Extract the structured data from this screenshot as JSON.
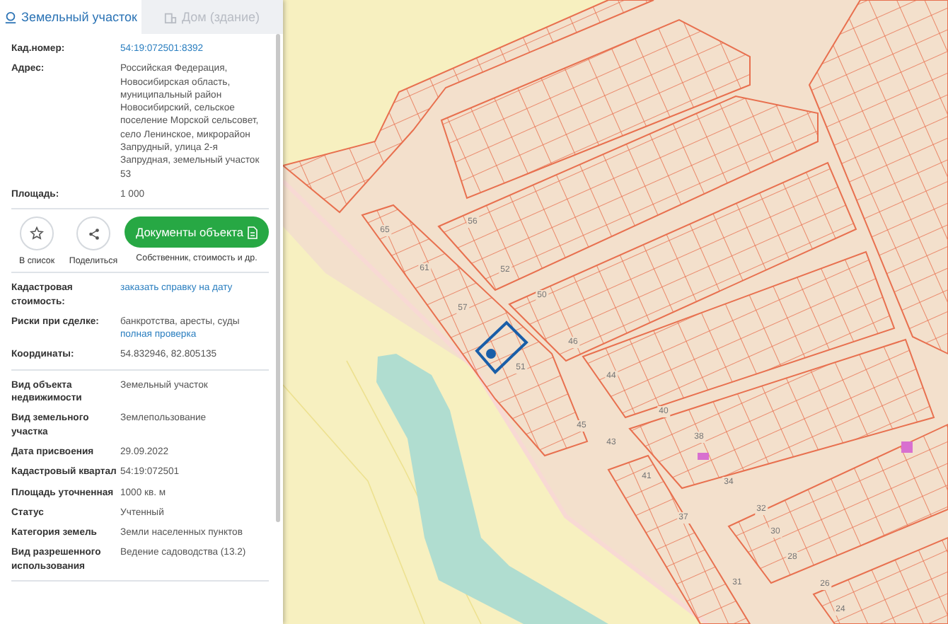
{
  "tabs": [
    {
      "label": "Земельный участок",
      "selected": true,
      "kind": "land"
    },
    {
      "label": "Дом (здание)",
      "selected": false,
      "kind": "building"
    }
  ],
  "groups": [
    {
      "rows": [
        {
          "label": "Кад.номер:",
          "values": [
            {
              "text": "54:19:072501:8392",
              "kind": "link"
            }
          ]
        },
        {
          "label": "Адрес:",
          "values": [
            {
              "text": "Российская Федерация, Новосибирская область, муниципальный район Новосибирский, сельское поселение Морской сельсовет, село Ленинское, микрорайон Запрудный, улица 2-я Запрудная, земельный участок 53",
              "kind": "plain"
            }
          ]
        },
        {
          "label": "Площадь:",
          "values": [
            {
              "text": "1 000",
              "kind": "plain"
            }
          ]
        }
      ]
    },
    {
      "actions": {
        "buttons": [
          {
            "label": "В список",
            "kind": "star"
          },
          {
            "label": "Поделиться",
            "kind": "share"
          }
        ],
        "primary": {
          "label": "Документы объекта",
          "caption": "Собственник, стоимость и др."
        }
      }
    },
    {
      "rows": [
        {
          "label": "Кадастровая стоимость:",
          "values": [
            {
              "text": "заказать справку на дату",
              "kind": "link"
            }
          ]
        },
        {
          "label": "Риски при сделке:",
          "values": [
            {
              "text": "банкротства, аресты, суды",
              "kind": "plain"
            },
            {
              "text": "полная проверка",
              "kind": "link"
            }
          ]
        },
        {
          "label": "Координаты:",
          "values": [
            {
              "text": "54.832946, 82.805135",
              "kind": "plain"
            }
          ]
        }
      ]
    },
    {
      "rows": [
        {
          "label": "Вид объекта недвижимости",
          "values": [
            {
              "text": "Земельный участок",
              "kind": "plain"
            }
          ]
        },
        {
          "label": "Вид земельного участка",
          "values": [
            {
              "text": "Землепользование",
              "kind": "plain"
            }
          ]
        },
        {
          "label": "Дата присвоения",
          "values": [
            {
              "text": "29.09.2022",
              "kind": "plain"
            }
          ]
        },
        {
          "label": "Кадастровый квартал",
          "values": [
            {
              "text": "54:19:072501",
              "kind": "plain"
            }
          ]
        },
        {
          "label": "Площадь уточненная",
          "values": [
            {
              "text": "1000 кв. м",
              "kind": "plain"
            }
          ]
        },
        {
          "label": "Статус",
          "values": [
            {
              "text": "Учтенный",
              "kind": "plain"
            }
          ]
        },
        {
          "label": "Категория земель",
          "values": [
            {
              "text": "Земли населенных пунктов",
              "kind": "plain"
            }
          ]
        },
        {
          "label": "Вид разрешенного использования",
          "values": [
            {
              "text": "Ведение садоводства (13.2)",
              "kind": "plain"
            }
          ]
        }
      ]
    }
  ],
  "map": {
    "plot_labels": [
      "65",
      "61",
      "57",
      "56",
      "52",
      "50",
      "46",
      "51",
      "44",
      "40",
      "45",
      "43",
      "38",
      "34",
      "41",
      "37",
      "32",
      "30",
      "28",
      "31",
      "26",
      "24"
    ]
  }
}
